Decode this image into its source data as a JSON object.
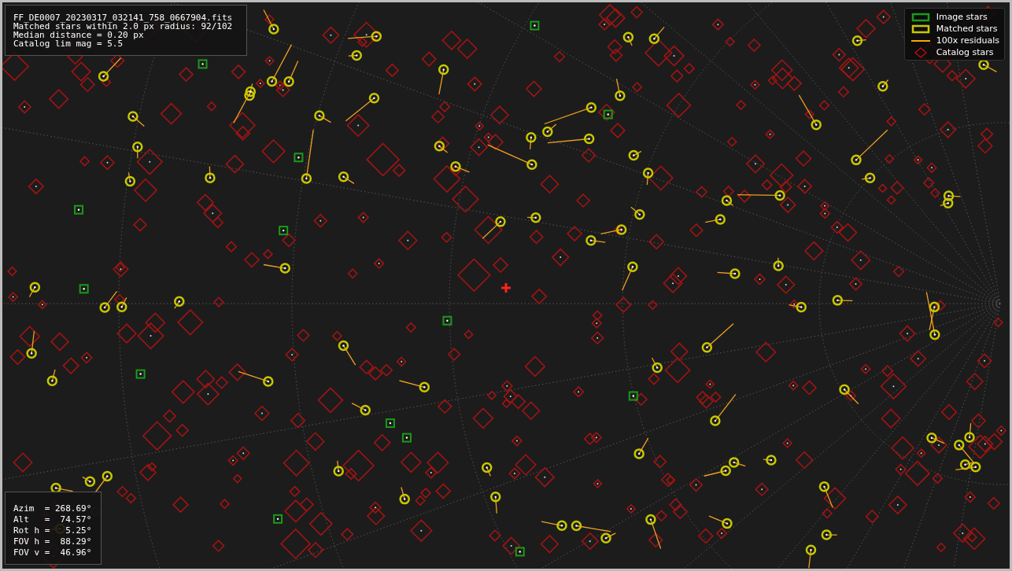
{
  "info_panel": {
    "lines": [
      "FF_DE0007_20230317_032141_758_0667904.fits",
      "Matched stars within 2.0 px radius: 92/102",
      "Median distance = 0.20 px",
      "Catalog lim mag = 5.5"
    ]
  },
  "legend": {
    "items": [
      {
        "label": "Image stars",
        "kind": "box",
        "color": "#1a9a1a"
      },
      {
        "label": "Matched stars",
        "kind": "box",
        "color": "#c8c800"
      },
      {
        "label": "100x residuals",
        "kind": "line",
        "color": "#ffa500"
      },
      {
        "label": "Catalog stars",
        "kind": "diamond",
        "color": "#b01010"
      }
    ]
  },
  "pointing_panel": {
    "lines": [
      "Azim  = 268.69°",
      "Alt   =  74.57°",
      "Rot h =   5.25°",
      "FOV h =  88.29°",
      "FOV v =  46.96°"
    ]
  }
}
